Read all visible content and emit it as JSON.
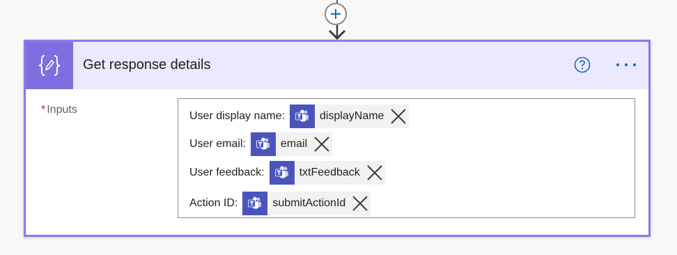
{
  "connector": {
    "add_step_icon": "plus-icon",
    "arrow_icon": "arrow-down-icon"
  },
  "card": {
    "title": "Get response details",
    "icon": "data-operation-icon",
    "accent": "#8a79f0",
    "header_bg": "#ece8fd",
    "icon_bg": "#7e6fe0",
    "help_icon": "help-circle-icon",
    "more_icon": "more-options-icon"
  },
  "inputs": {
    "required_marker": "*",
    "label": "Inputs",
    "lines": [
      {
        "prefix": "User display name:",
        "token": "displayName"
      },
      {
        "prefix": "User email:",
        "token": "email"
      },
      {
        "prefix": "User feedback:",
        "token": "txtFeedback"
      },
      {
        "prefix": "Action ID:",
        "token": "submitActionId"
      }
    ],
    "token_icon": "teams-icon",
    "token_icon_color": "#4b53bc",
    "token_remove_icon": "close-icon"
  }
}
